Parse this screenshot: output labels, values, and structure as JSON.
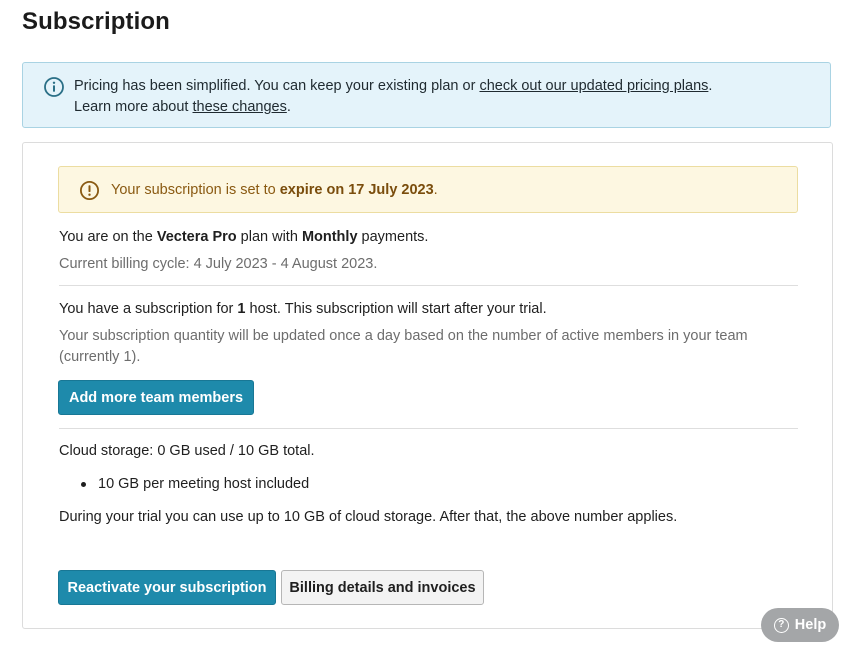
{
  "page": {
    "title": "Subscription"
  },
  "info_banner": {
    "icon": "info-circle-icon",
    "text_before": "Pricing has been simplified. You can keep your existing plan or ",
    "link_pricing": "check out our updated pricing plans",
    "text_after": ".",
    "line2_before": "Learn more about ",
    "link_changes": "these changes",
    "line2_after": "."
  },
  "warning_banner": {
    "icon": "exclamation-circle-icon",
    "text_before": "Your subscription is set to ",
    "text_strong": "expire on 17 July 2023",
    "text_after": "."
  },
  "plan": {
    "prefix": "You are on the ",
    "plan_name": "Vectera Pro",
    "middle": " plan with ",
    "payment": "Monthly",
    "suffix": " payments.",
    "billing_cycle": "Current billing cycle: 4 July 2023 - 4 August 2023."
  },
  "hosts": {
    "prefix": "You have a subscription for ",
    "count": "1",
    "suffix": " host. This subscription will start after your trial.",
    "note": "Your subscription quantity will be updated once a day based on the number of active members in your team (currently 1).",
    "add_button": "Add more team members"
  },
  "storage": {
    "summary": "Cloud storage: 0 GB used / 10 GB total.",
    "bullets": [
      "10 GB per meeting host included"
    ],
    "trial_note": "During your trial you can use up to 10 GB of cloud storage. After that, the above number applies."
  },
  "actions": {
    "reactivate": "Reactivate your subscription",
    "billing": "Billing details and invoices"
  },
  "help": {
    "label": "Help",
    "icon": "question-circle-icon"
  },
  "colors": {
    "accent": "#1e8aab",
    "info_bg": "#e4f3fa",
    "warning_bg": "#fdf7e1",
    "warning_text": "#8a5a12"
  }
}
